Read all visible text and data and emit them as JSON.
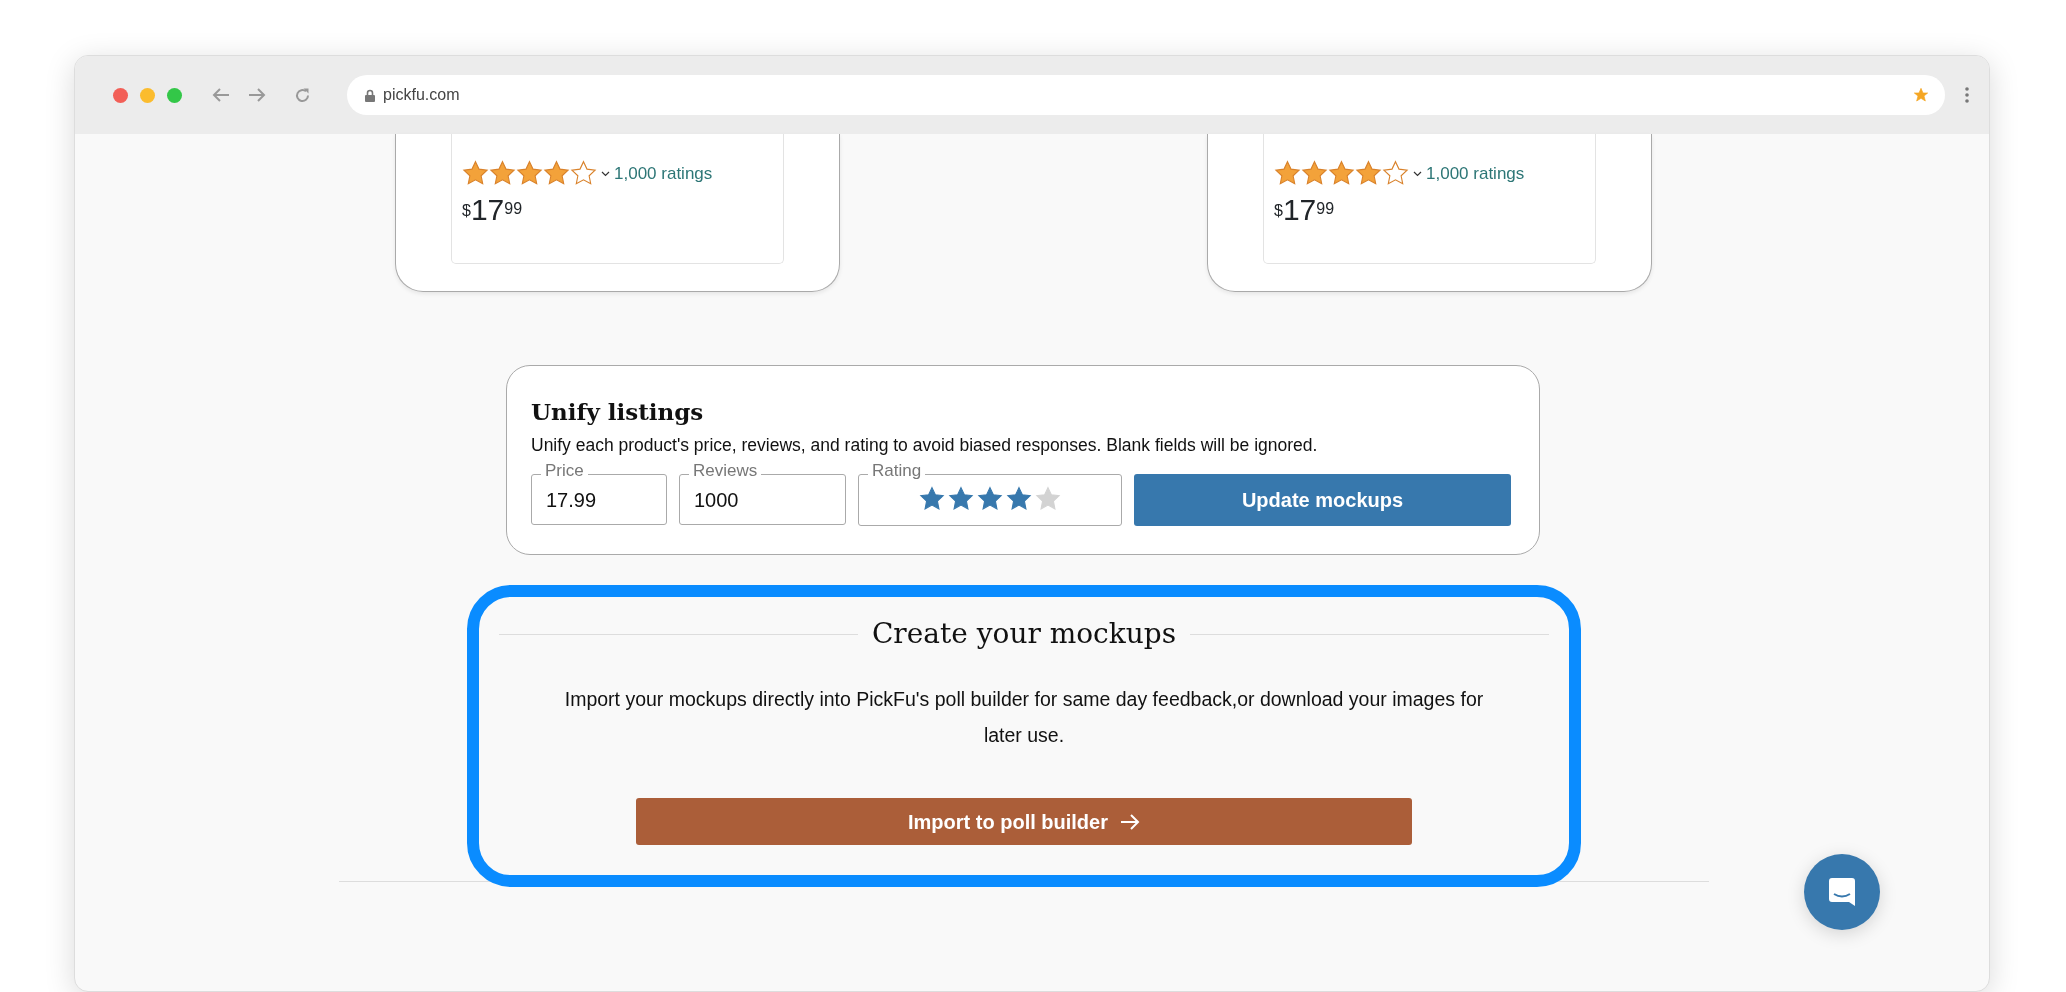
{
  "browser": {
    "url": "pickfu.com",
    "bookmarked": true
  },
  "products": [
    {
      "stars": 4,
      "ratings": "1,000 ratings",
      "currency": "$",
      "price_whole": "17",
      "price_fraction": "99"
    },
    {
      "stars": 4,
      "ratings": "1,000 ratings",
      "currency": "$",
      "price_whole": "17",
      "price_fraction": "99"
    }
  ],
  "unify": {
    "title": "Unify listings",
    "description": "Unify each product's price, reviews, and rating to avoid biased responses. Blank fields will be ignored.",
    "fields": [
      {
        "label": "Price",
        "value": "17.99"
      },
      {
        "label": "Reviews",
        "value": "1000"
      }
    ],
    "rating": {
      "label": "Rating",
      "stars": 4
    },
    "button": "Update mockups"
  },
  "create": {
    "title": "Create your mockups",
    "description": "Import your mockups directly into PickFu's poll builder for same day feedback,or download your images for later use.",
    "button": "Import to poll builder"
  }
}
